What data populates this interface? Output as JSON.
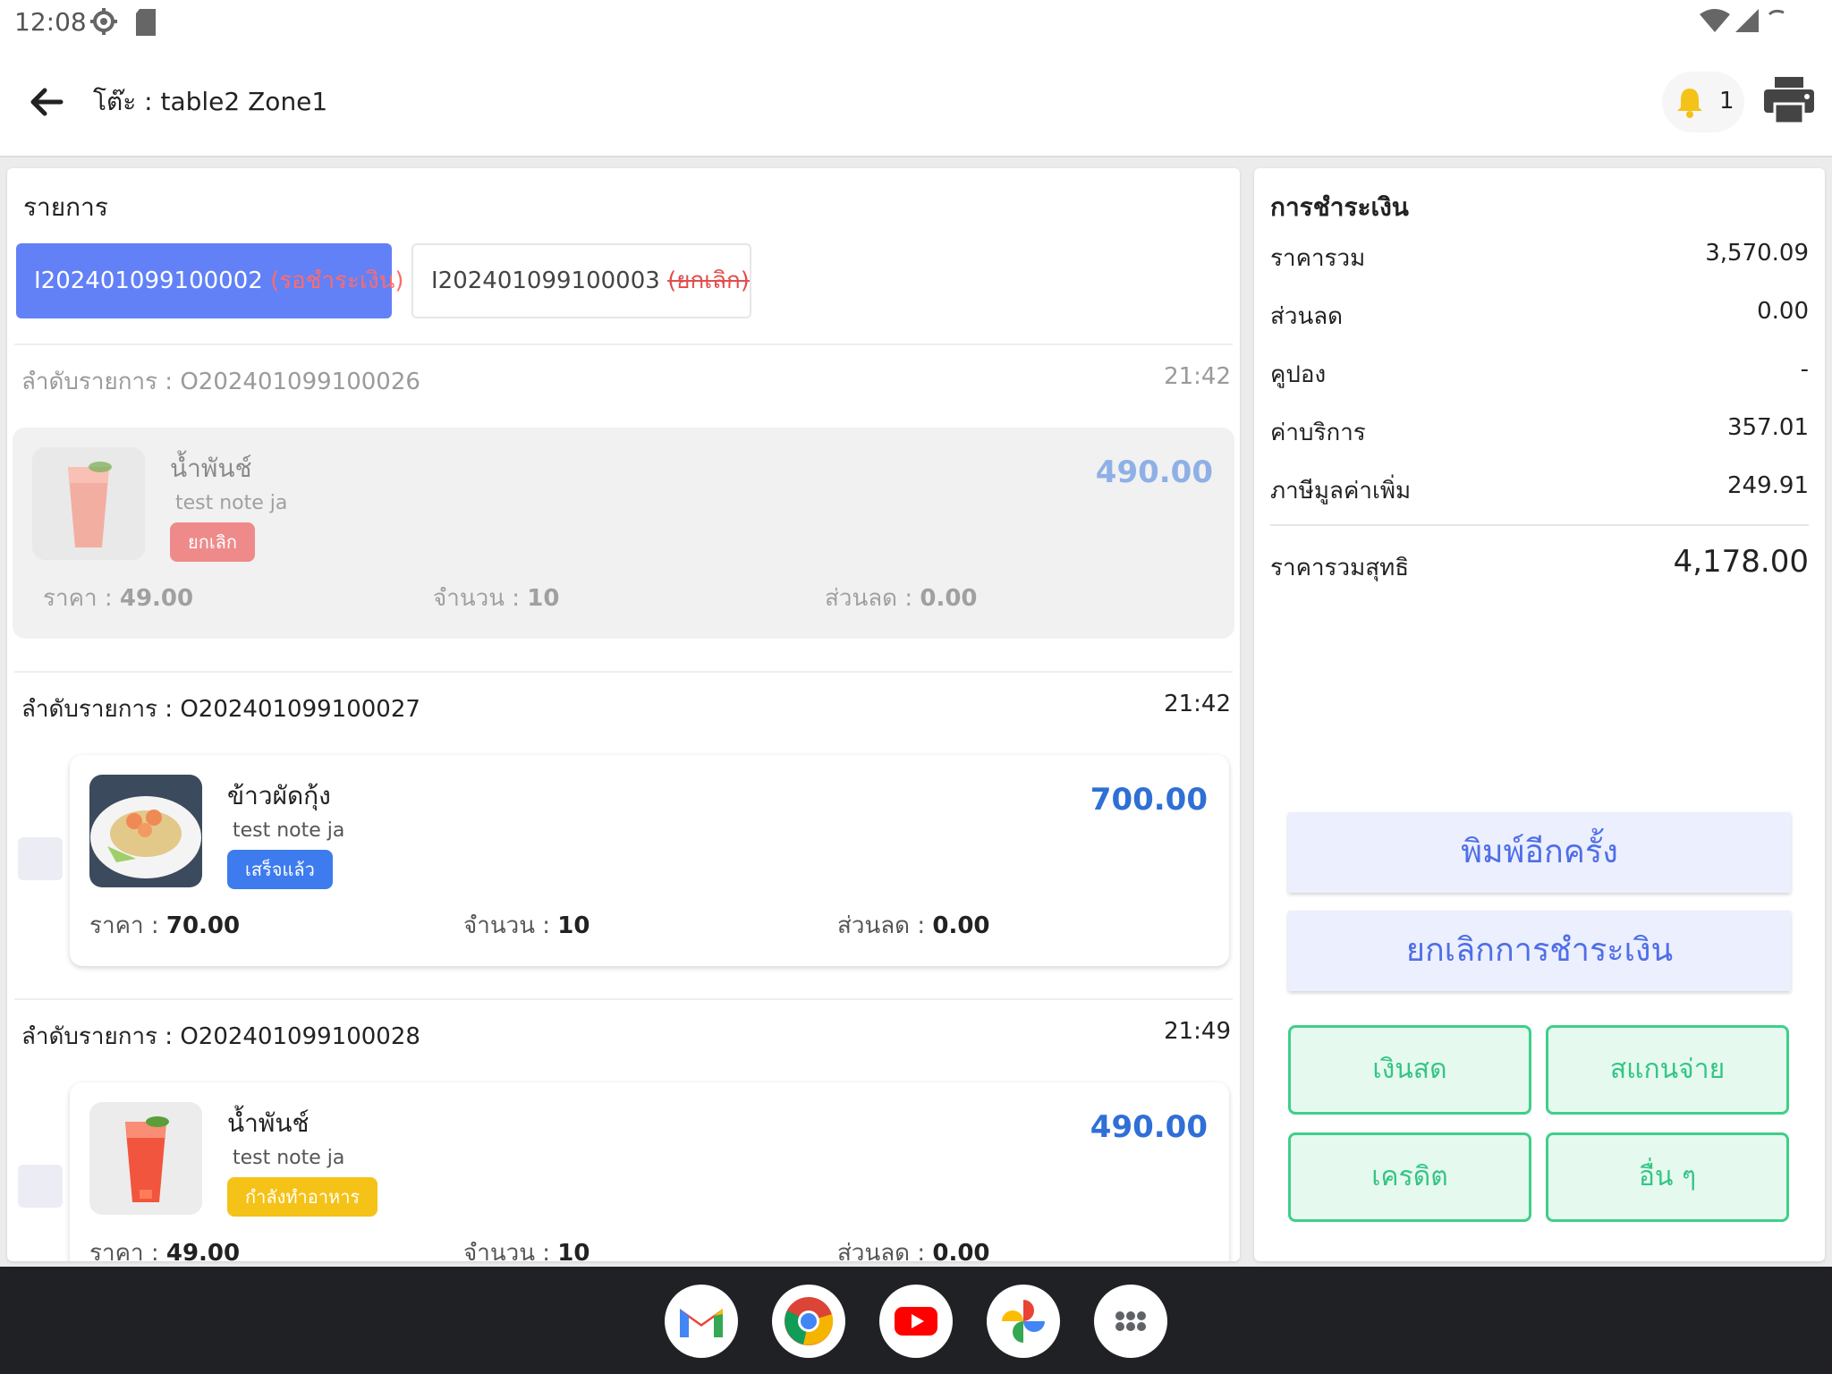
{
  "status_bar": {
    "time": "12:08"
  },
  "header": {
    "title": "โต๊ะ : table2 Zone1",
    "notification_count": "1"
  },
  "left": {
    "title": "รายการ",
    "bills": [
      {
        "id": "I202401099100002",
        "status": "(รอชำระเงิน)"
      },
      {
        "id": "I202401099100003",
        "status": "(ยกเลิก)"
      }
    ],
    "orders": [
      {
        "label": "ลำดับรายการ : O202401099100026",
        "time": "21:42",
        "item": {
          "name": "น้ำพันช์",
          "note": "test note ja",
          "status": "ยกเลิก",
          "price": "490.00",
          "unit_label": "ราคา :",
          "unit_price": "49.00",
          "qty_label": "จำนวน :",
          "qty": "10",
          "discount_label": "ส่วนลด :",
          "discount": "0.00"
        }
      },
      {
        "label": "ลำดับรายการ : O202401099100027",
        "time": "21:42",
        "item": {
          "name": "ข้าวผัดกุ้ง",
          "note": "test note ja",
          "status": "เสร็จแล้ว",
          "price": "700.00",
          "unit_label": "ราคา :",
          "unit_price": "70.00",
          "qty_label": "จำนวน :",
          "qty": "10",
          "discount_label": "ส่วนลด :",
          "discount": "0.00"
        }
      },
      {
        "label": "ลำดับรายการ : O202401099100028",
        "time": "21:49",
        "item": {
          "name": "น้ำพันช์",
          "note": "test note ja",
          "status": "กำลังทำอาหาร",
          "price": "490.00",
          "unit_label": "ราคา :",
          "unit_price": "49.00",
          "qty_label": "จำนวน :",
          "qty": "10",
          "discount_label": "ส่วนลด :",
          "discount": "0.00"
        }
      }
    ]
  },
  "payment": {
    "title": "การชำระเงิน",
    "rows": [
      {
        "label": "ราคารวม",
        "value": "3,570.09"
      },
      {
        "label": "ส่วนลด",
        "value": "0.00"
      },
      {
        "label": "คูปอง",
        "value": "-"
      },
      {
        "label": "ค่าบริการ",
        "value": "357.01"
      },
      {
        "label": "ภาษีมูลค่าเพิ่ม",
        "value": "249.91"
      }
    ],
    "total_label": "ราคารวมสุทธิ",
    "total_value": "4,178.00",
    "reprint_label": "พิมพ์อีกครั้ง",
    "cancel_payment_label": "ยกเลิกการชำระเงิน",
    "methods": [
      "เงินสด",
      "สแกนจ่าย",
      "เครดิต",
      "อื่น ๆ"
    ]
  },
  "dock": {
    "apps": [
      "gmail-icon",
      "chrome-icon",
      "youtube-icon",
      "photos-icon",
      "app-drawer-icon"
    ]
  },
  "colors": {
    "accent": "#6281f7",
    "price_blue": "#2f6fd6",
    "pay_green": "#3fcf8a",
    "status_red": "#e24d4d"
  }
}
